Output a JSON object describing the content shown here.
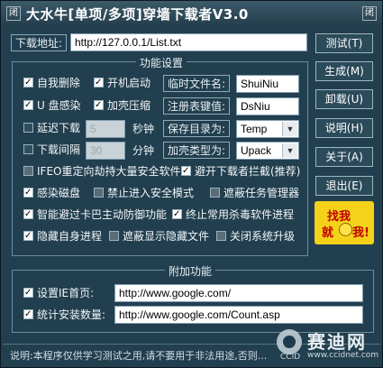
{
  "titlebar": {
    "icon": "闭",
    "title": "大水牛[单项/多项]穿墙下载者V3.0",
    "close": "闭"
  },
  "download": {
    "label": "下载地址:",
    "url": "http://127.0.0.1/List.txt"
  },
  "settings": {
    "title": "功能设置",
    "auto_delete": "自我删除",
    "auto_start": "开机启动",
    "temp_filename_label": "临时文件名:",
    "temp_filename": "ShuiNiu",
    "usb_infect": "U 盘感染",
    "add_shell_compress": "加壳压缩",
    "reg_key_label": "注册表键值:",
    "reg_key": "DsNiu",
    "delay_download": "延迟下载",
    "delay_value": "5",
    "seconds": "秒钟",
    "save_dir_label": "保存目录为:",
    "save_dir": "Temp",
    "download_interval": "下载间隔",
    "interval_value": "30",
    "minutes": "分钟",
    "shell_type_label": "加壳类型为:",
    "shell_type": "Upack",
    "ifeo": "IFEO重定向劫持大量安全软件",
    "avoid_intercept": "避开下载者拦截(推荐)",
    "infect_disk": "感染磁盘",
    "no_safe_mode": "禁止进入安全模式",
    "block_taskmgr": "遮蔽任务管理器",
    "avoid_kaba": "智能避过卡巴主动防御功能",
    "kill_av": "终止常用杀毒软件进程",
    "hide_self": "隐藏自身进程",
    "block_hidden_files": "遮蔽显示隐藏文件",
    "disable_update": "关闭系统升级"
  },
  "extra": {
    "title": "附加功能",
    "homepage_label": "设置IE首页:",
    "homepage": "http://www.google.com/",
    "stats_label": "统计安装数量:",
    "stats": "http://www.google.com/Count.asp"
  },
  "buttons": {
    "test": "测试(T)",
    "generate": "生成(M)",
    "uninstall": "卸载(U)",
    "help": "说明(H)",
    "about": "关于(A)",
    "exit": "退出(E)"
  },
  "sticker": {
    "line1": "找我",
    "line2": "就",
    "line2b": "我!"
  },
  "status": "说明:本程序仅供学习测试之用,请不要用于非法用途,否则...",
  "watermark": {
    "cn": "赛迪网",
    "en": "www.ccidnet.com",
    "ccid": "CCID"
  }
}
